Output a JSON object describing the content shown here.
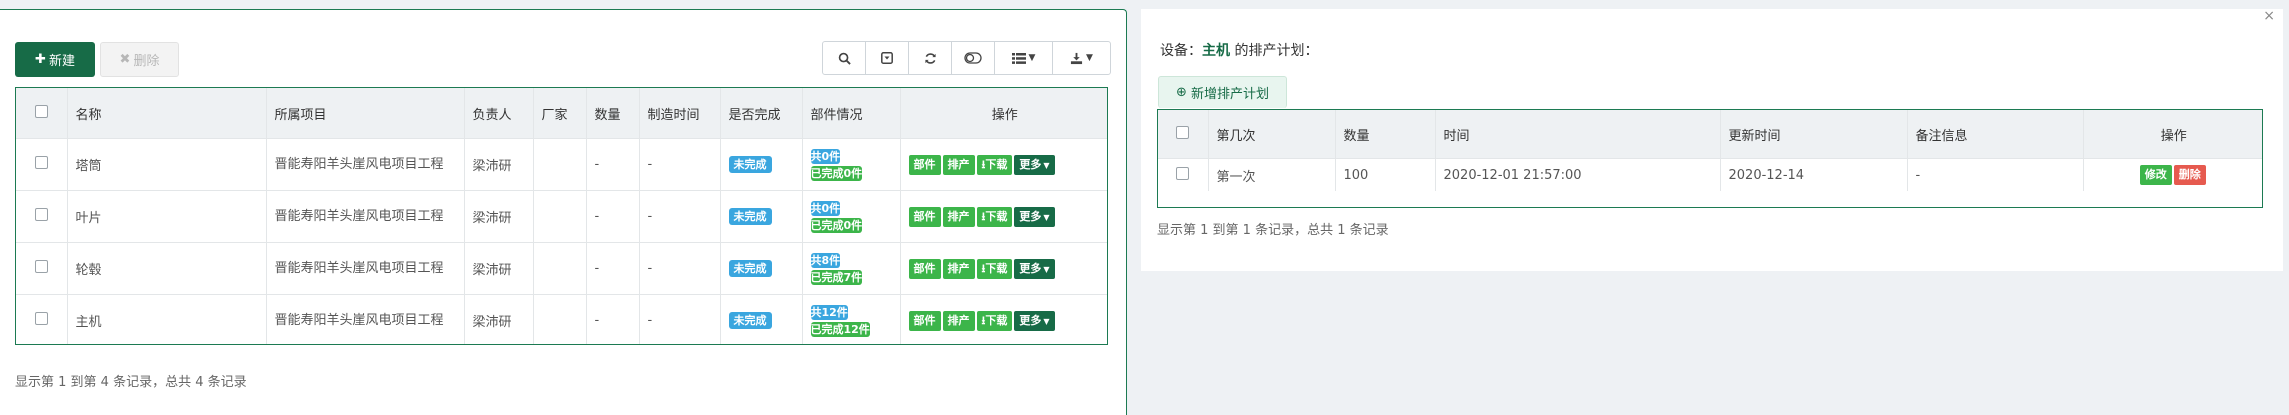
{
  "left": {
    "new_label": "新建",
    "delete_label": "删除",
    "toolbar": {
      "icons": [
        "search-icon",
        "toggle-icon",
        "refresh-icon",
        "switch-icon",
        "columns-icon",
        "export-icon"
      ]
    },
    "table": {
      "headers": [
        "名称",
        "所属项目",
        "负责人",
        "厂家",
        "数量",
        "制造时间",
        "是否完成",
        "部件情况",
        "操作"
      ],
      "rows": [
        {
          "name": "塔筒",
          "project": "晋能寿阳羊头崖风电项目工程",
          "owner": "梁沛研",
          "vendor": "",
          "qty": "-",
          "made": "-",
          "status": "未完成",
          "total": "共0件",
          "done": "已完成0件"
        },
        {
          "name": "叶片",
          "project": "晋能寿阳羊头崖风电项目工程",
          "owner": "梁沛研",
          "vendor": "",
          "qty": "-",
          "made": "-",
          "status": "未完成",
          "total": "共0件",
          "done": "已完成0件"
        },
        {
          "name": "轮毂",
          "project": "晋能寿阳羊头崖风电项目工程",
          "owner": "梁沛研",
          "vendor": "",
          "qty": "-",
          "made": "-",
          "status": "未完成",
          "total": "共8件",
          "done": "已完成7件"
        },
        {
          "name": "主机",
          "project": "晋能寿阳羊头崖风电项目工程",
          "owner": "梁沛研",
          "vendor": "",
          "qty": "-",
          "made": "-",
          "status": "未完成",
          "total": "共12件",
          "done": "已完成12件"
        }
      ],
      "actions": {
        "parts": "部件",
        "schedule": "排产",
        "download": "下载",
        "more": "更多"
      }
    },
    "footer": "显示第 1 到第 4 条记录，总共 4 条记录"
  },
  "right": {
    "title_prefix": "设备：",
    "device": "主机",
    "title_suffix": " 的排产计划：",
    "add_plan_label": "新增排产计划",
    "table": {
      "headers": [
        "第几次",
        "数量",
        "时间",
        "更新时间",
        "备注信息",
        "操作"
      ],
      "rows": [
        {
          "nth": "第一次",
          "qty": "100",
          "time": "2020-12-01 21:57:00",
          "updated": "2020-12-14",
          "note": "-",
          "edit": "修改",
          "delete": "删除"
        }
      ]
    },
    "footer": "显示第 1 到第 1 条记录，总共 1 条记录",
    "close": "×"
  },
  "colors": {
    "primary": "#176b47",
    "badge_blue": "#3aa6df",
    "badge_green": "#3cb54a",
    "danger": "#e65a4f"
  }
}
